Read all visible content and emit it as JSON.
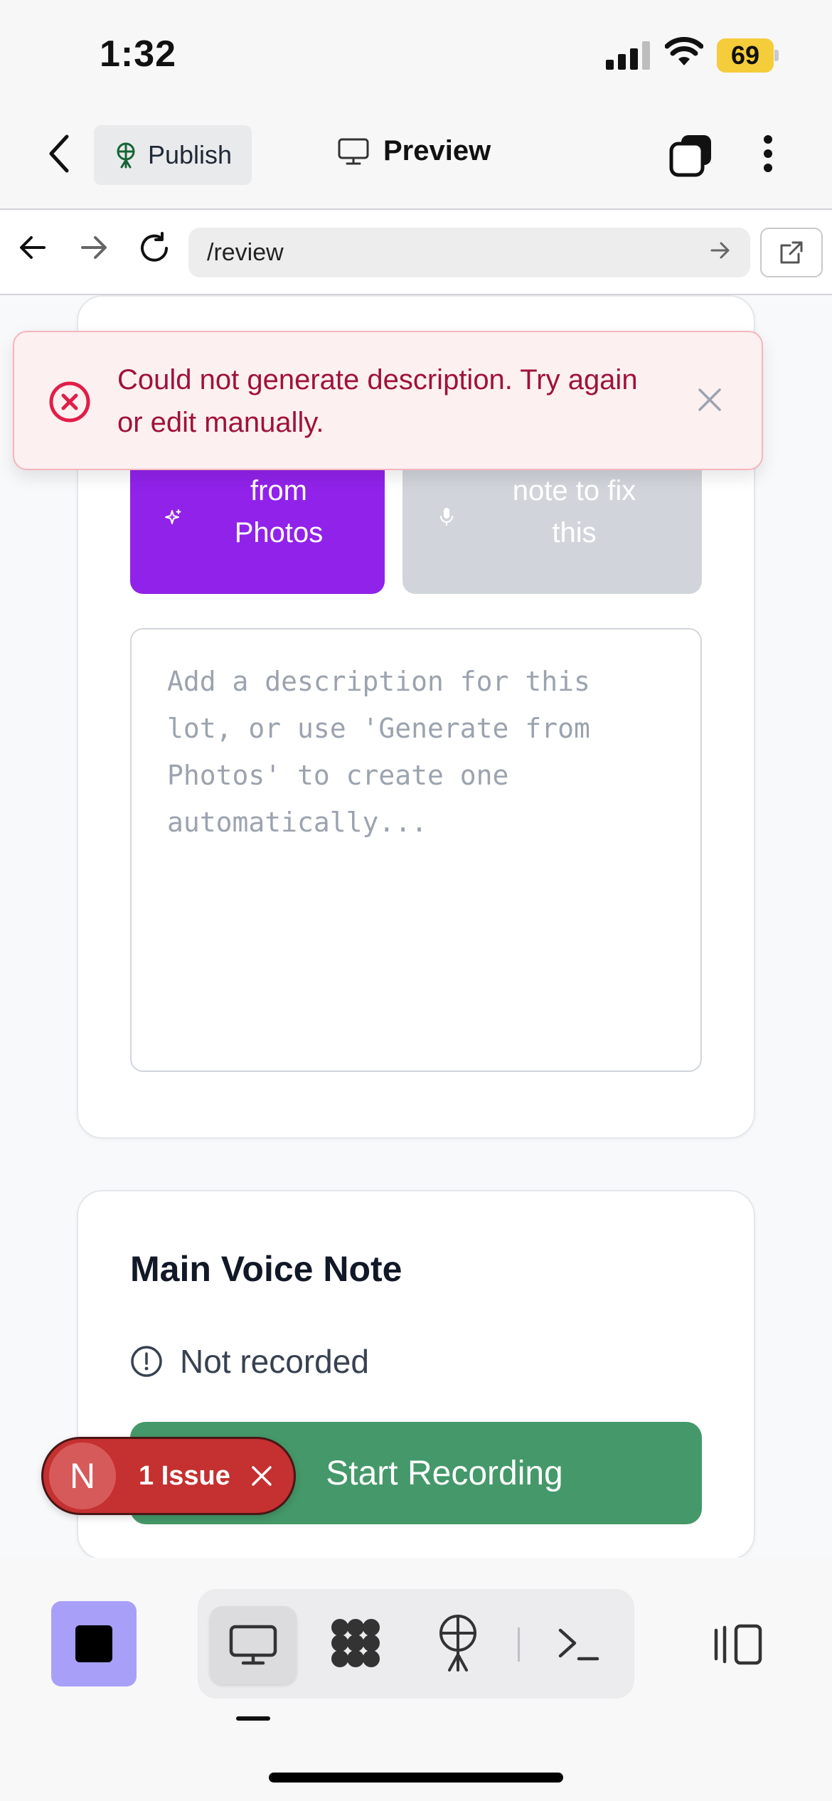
{
  "status_bar": {
    "time": "1:32",
    "battery": "69"
  },
  "header": {
    "publish_label": "Publish",
    "preview_label": "Preview"
  },
  "browser": {
    "url": "/review"
  },
  "description_card": {
    "generate_label": "Generate\nfrom\nPhotos",
    "voice_fix_label": "Use my voice\nnote to fix\nthis",
    "placeholder": "Add a description for this lot, or use 'Generate from Photos' to create one automatically..."
  },
  "toast": {
    "message": "Could not generate description. Try again or edit manually."
  },
  "voice_card": {
    "title": "Main Voice Note",
    "status": "Not recorded",
    "record_label": "Start Recording"
  },
  "issue_badge": {
    "avatar_letter": "N",
    "label": "1 Issue"
  },
  "colors": {
    "accent_purple": "#9122ea",
    "record_green": "#449869",
    "error_red": "#c53030",
    "toast_text": "#9f1239"
  }
}
